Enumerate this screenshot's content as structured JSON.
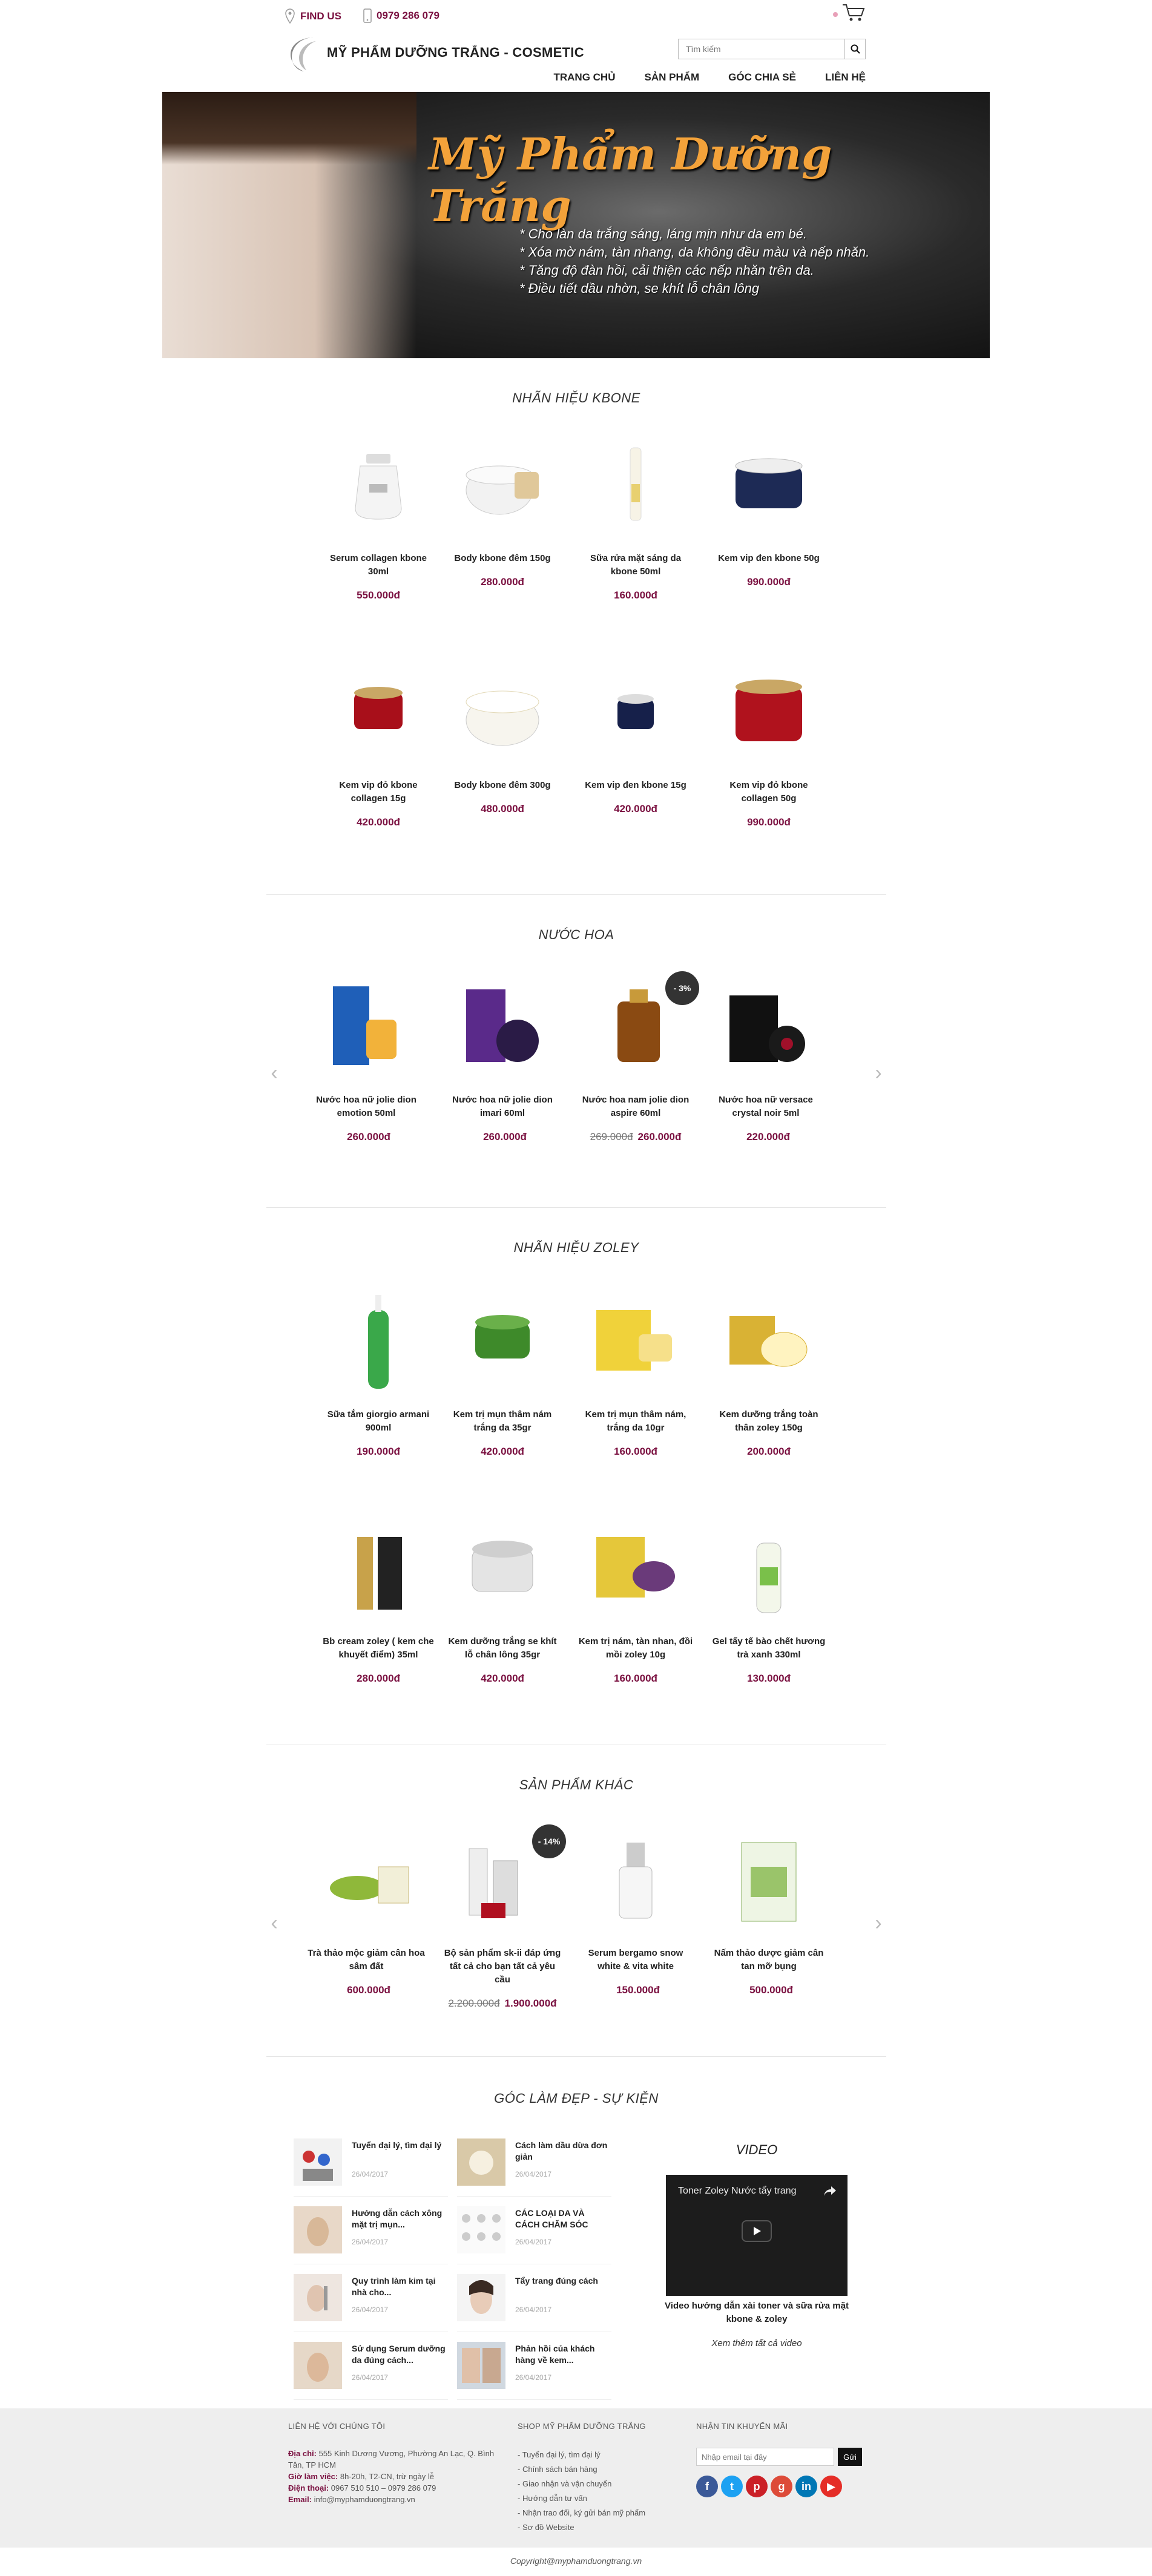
{
  "header": {
    "find_us": "FIND US",
    "phone": "0979 286 079",
    "brand": "MỸ PHẨM DƯỠNG TRẮNG - COSMETIC",
    "search_placeholder": "Tìm kiếm",
    "nav": [
      "TRANG CHỦ",
      "SẢN PHẨM",
      "GÓC CHIA SẺ",
      "LIÊN HỆ"
    ]
  },
  "banner": {
    "title": "Mỹ Phẩm Dưỡng Trắng",
    "bullets": [
      "* Cho làn da trắng sáng, láng mịn như da em bé.",
      "* Xóa mờ nám, tàn nhang, da không đều màu và nếp nhăn.",
      "* Tăng độ đàn hồi, cải thiện các nếp nhăn trên da.",
      "* Điều tiết dầu nhờn, se khít lỗ chân lông"
    ]
  },
  "sections": {
    "kbone": {
      "title": "NHÃN HIỆU KBONE",
      "products": [
        {
          "name": "Serum collagen kbone 30ml",
          "price": "550.000đ"
        },
        {
          "name": "Body kbone đêm 150g",
          "price": "280.000đ"
        },
        {
          "name": "Sữa rửa mặt sáng da kbone 50ml",
          "price": "160.000đ"
        },
        {
          "name": "Kem vip đen kbone 50g",
          "price": "990.000đ"
        },
        {
          "name": "Kem vip đỏ kbone collagen 15g",
          "price": "420.000đ"
        },
        {
          "name": "Body kbone đêm 300g",
          "price": "480.000đ"
        },
        {
          "name": "Kem vip đen kbone 15g",
          "price": "420.000đ"
        },
        {
          "name": "Kem vip đỏ kbone collagen 50g",
          "price": "990.000đ"
        }
      ]
    },
    "perfume": {
      "title": "NƯỚC HOA",
      "products": [
        {
          "name": "Nước hoa nữ jolie dion emotion 50ml",
          "price": "260.000đ",
          "old_price": "",
          "badge": ""
        },
        {
          "name": "Nước hoa nữ jolie dion imari 60ml",
          "price": "260.000đ",
          "old_price": "",
          "badge": ""
        },
        {
          "name": "Nước hoa nam jolie dion aspire 60ml",
          "price": "260.000đ",
          "old_price": "269.000đ",
          "badge": "- 3%"
        },
        {
          "name": "Nước hoa nữ versace crystal noir 5ml",
          "price": "220.000đ",
          "old_price": "",
          "badge": ""
        }
      ]
    },
    "zoley": {
      "title": "NHÃN HIỆU ZOLEY",
      "products": [
        {
          "name": "Sữa tắm giorgio armani 900ml",
          "price": "190.000đ"
        },
        {
          "name": "Kem trị mụn thâm nám trắng da 35gr",
          "price": "420.000đ"
        },
        {
          "name": "Kem trị mụn thâm nám, trắng da 10gr",
          "price": "160.000đ"
        },
        {
          "name": "Kem dưỡng trắng toàn thân zoley 150g",
          "price": "200.000đ"
        },
        {
          "name": "Bb cream zoley ( kem che khuyết điểm) 35ml",
          "price": "280.000đ"
        },
        {
          "name": "Kem dưỡng trắng se khít lỗ chân lông 35gr",
          "price": "420.000đ"
        },
        {
          "name": "Kem trị nám, tàn nhan, đồi mồi zoley 10g",
          "price": "160.000đ"
        },
        {
          "name": "Gel tẩy tế bào chết hương trà xanh 330ml",
          "price": "130.000đ"
        }
      ]
    },
    "other": {
      "title": "SẢN PHẨM KHÁC",
      "products": [
        {
          "name": "Trà thảo mộc giảm cân hoa sâm đất",
          "price": "600.000đ",
          "old_price": "",
          "badge": ""
        },
        {
          "name": "Bộ sản phẩm sk-ii đáp ứng tất cả cho bạn tất cả yêu cầu",
          "price": "1.900.000đ",
          "old_price": "2.200.000đ",
          "badge": "- 14%"
        },
        {
          "name": "Serum bergamo snow white & vita white",
          "price": "150.000đ",
          "old_price": "",
          "badge": ""
        },
        {
          "name": "Nấm thảo dược giảm cân tan mỡ bụng",
          "price": "500.000đ",
          "old_price": "",
          "badge": ""
        }
      ]
    },
    "blog": {
      "title": "GÓC LÀM ĐẸP - SỰ KIỆN",
      "posts": [
        {
          "title": "Tuyển đại lý, tìm đại lý",
          "date": "26/04/2017"
        },
        {
          "title": "Cách làm dầu dừa đơn giản",
          "date": "26/04/2017"
        },
        {
          "title": "Hướng dẫn cách xông mặt trị mụn...",
          "date": "26/04/2017"
        },
        {
          "title": "CÁC LOẠI DA VÀ CÁCH CHĂM SÓC",
          "date": "26/04/2017"
        },
        {
          "title": "Quy trình làm kim tại nhà cho...",
          "date": "26/04/2017"
        },
        {
          "title": "Tẩy trang đúng cách",
          "date": "26/04/2017"
        },
        {
          "title": "Sử dụng Serum dưỡng da đúng cách...",
          "date": "26/04/2017"
        },
        {
          "title": "Phản hồi của khách hàng về kem...",
          "date": "26/04/2017"
        }
      ]
    },
    "video": {
      "title": "VIDEO",
      "player_title": "Toner Zoley Nước tẩy trang",
      "caption": "Video hướng dẫn xài toner và sữa rửa mặt kbone & zoley",
      "more": "Xem thêm tất cả video"
    }
  },
  "footer": {
    "contact": {
      "heading": "LIÊN HỆ VỚI CHÚNG TÔI",
      "address_label": "Địa chỉ:",
      "address": "555 Kinh Dương Vương, Phường An Lạc, Q. Bình Tân, TP HCM",
      "hours_label": "Giờ làm việc:",
      "hours": "8h-20h, T2-CN, trừ ngày lễ",
      "phone_label": "Điện thoại:",
      "phone": "0967 510 510 – 0979 286 079",
      "email_label": "Email:",
      "email": "info@myphamduongtrang.vn"
    },
    "shop": {
      "heading": "SHOP MỸ PHẨM DƯỠNG TRẮNG",
      "links": [
        "Tuyển đại lý, tìm đại lý",
        "Chính sách bán hàng",
        "Giao nhận và vận chuyển",
        "Hướng dẫn tư vấn",
        "Nhận trao đổi, ký gửi bán mỹ phẩm",
        "Sơ đồ Website"
      ]
    },
    "newsletter": {
      "heading": "NHẬN TIN KHUYẾN MÃI",
      "placeholder": "Nhập email tại đây",
      "button": "Gửi"
    },
    "copyright": "Copyright@myphamduongtrang.vn"
  },
  "colors": {
    "accent": "#7a1040",
    "badge": "#333333",
    "footer_bg": "#eeeeee"
  }
}
